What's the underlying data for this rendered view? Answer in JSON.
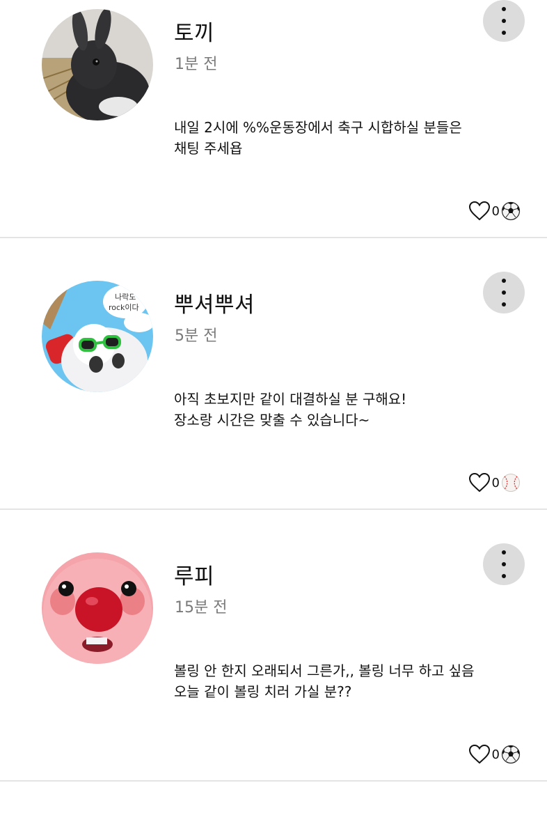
{
  "posts": [
    {
      "author": "토끼",
      "time": "1분 전",
      "content": "내일 2시에 %%운동장에서 축구 시합하실 분들은\n채팅 주세욥",
      "likes": "0",
      "avatar_icon": "rabbit-avatar",
      "sport_icon": "soccer-ball-icon"
    },
    {
      "author": "뿌셔뿌셔",
      "time": "5분 전",
      "content": "아직 초보지만 같이 대결하실 분 구해요!\n장소랑 시간은 맞출 수 있습니다~",
      "likes": "0",
      "avatar_icon": "cartoon-character-avatar",
      "avatar_text_1": "나락도",
      "avatar_text_2": "rock이다",
      "sport_icon": "baseball-icon"
    },
    {
      "author": "루피",
      "time": "15분 전",
      "content": "볼링 안 한지 오래되서 그른가,, 볼링 너무 하고 싶음\n오늘 같이 볼링 치러 가실 분??",
      "likes": "0",
      "avatar_icon": "pink-beaver-avatar",
      "sport_icon": "soccer-ball-icon"
    }
  ]
}
